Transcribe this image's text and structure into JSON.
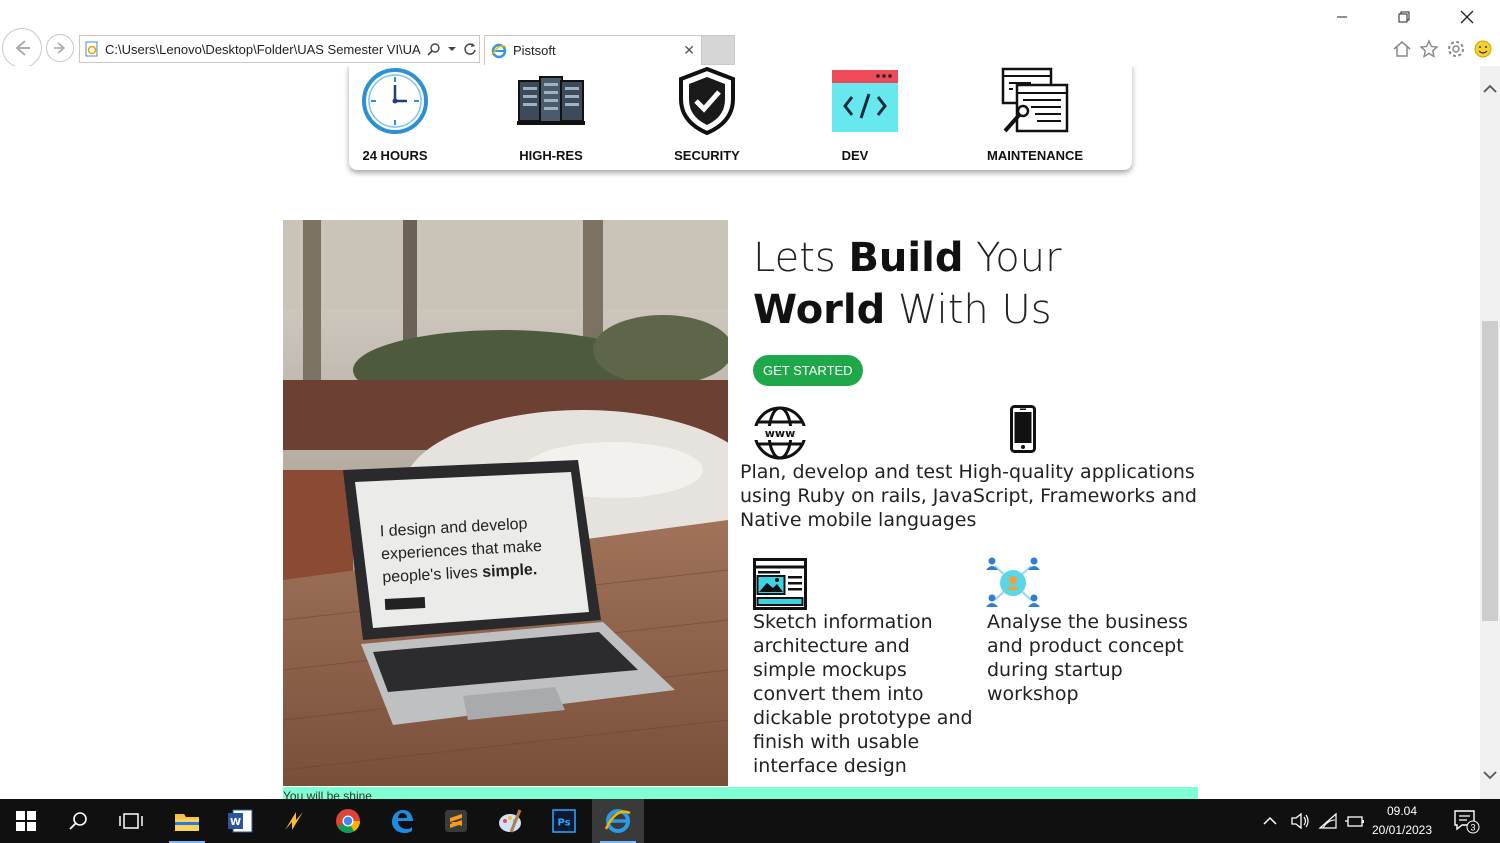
{
  "browser": {
    "address": "C:\\Users\\Lenovo\\Desktop\\Folder\\UAS Semester VI\\UA",
    "tab_title": "Pistsoft"
  },
  "features": [
    {
      "label": "24 HOURS",
      "icon": "clock-icon"
    },
    {
      "label": "HIGH-RES",
      "icon": "servers-icon"
    },
    {
      "label": "SECURITY",
      "icon": "shield-check-icon"
    },
    {
      "label": "DEV",
      "icon": "code-window-icon"
    },
    {
      "label": "MAINTENANCE",
      "icon": "maintenance-icon"
    }
  ],
  "hero": {
    "line1_light": "Lets ",
    "line1_bold": "Build",
    "line1_rest": " Your",
    "line2_bold": "World",
    "line2_rest": " With Us",
    "cta": "GET STARTED"
  },
  "photo": {
    "screen_text_1": "I design and develop",
    "screen_text_2": "experiences that make",
    "screen_text_3": "people's lives ",
    "screen_text_bold": "simple."
  },
  "services": {
    "web_mobile_text": "Plan, develop and test High-quality applications using Ruby on rails, JavaScript, Frameworks and Native mobile languages",
    "design_text": "Sketch information architecture and simple mockups convert them into dickable prototype and finish with usable interface design",
    "analysis_text": "Analyse the business and product concept during startup workshop"
  },
  "bottom_bar": {
    "text": "You will be shine"
  },
  "taskbar": {
    "time": "09.04",
    "date": "20/01/2023",
    "notifications": "3"
  },
  "colors": {
    "cta": "#1fa84a",
    "bottom_bar": "#7fffd4",
    "clock_blue": "#2d8fd6",
    "taskbar": "#101010"
  }
}
